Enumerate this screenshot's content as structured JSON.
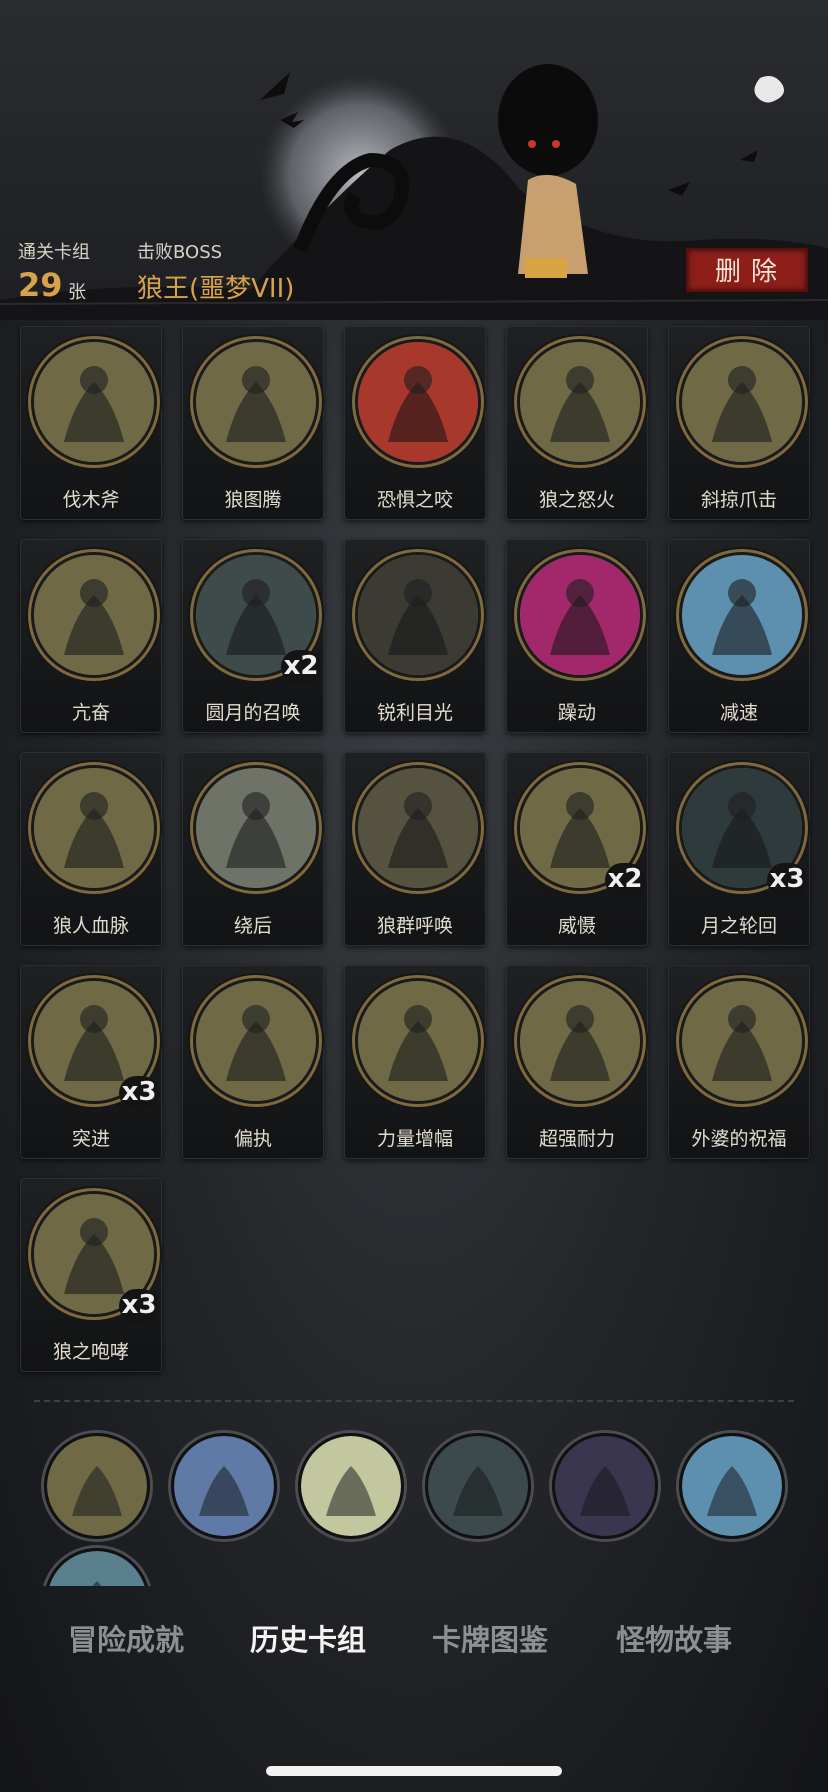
{
  "header": {
    "cleared_decks_label": "通关卡组",
    "cleared_decks_value": "29",
    "cleared_decks_unit": "张",
    "defeated_boss_label": "击败BOSS",
    "defeated_boss_name": "狼王(噩梦VII)",
    "delete_label": "删除"
  },
  "cards": [
    {
      "name": "伐木斧",
      "count": "",
      "icon": "axe-icon",
      "color": "#6f6a45"
    },
    {
      "name": "狼图腾",
      "count": "",
      "icon": "wolf-totem-icon",
      "color": "#6f6a45"
    },
    {
      "name": "恐惧之咬",
      "count": "",
      "icon": "skull-bite-icon",
      "color": "#a8372c"
    },
    {
      "name": "狼之怒火",
      "count": "",
      "icon": "wolf-rage-icon",
      "color": "#6f6a45"
    },
    {
      "name": "斜掠爪击",
      "count": "",
      "icon": "claw-slash-icon",
      "color": "#6f6a45"
    },
    {
      "name": "亢奋",
      "count": "",
      "icon": "werewolf-excite-icon",
      "color": "#6f6a45"
    },
    {
      "name": "圆月的召唤",
      "count": "x2",
      "icon": "full-moon-icon",
      "color": "#3f4a4a"
    },
    {
      "name": "锐利目光",
      "count": "",
      "icon": "sharp-eyes-icon",
      "color": "#3b3b33"
    },
    {
      "name": "躁动",
      "count": "",
      "icon": "restless-icon",
      "color": "#a3286b"
    },
    {
      "name": "减速",
      "count": "",
      "icon": "slow-clock-icon",
      "color": "#5d8fae"
    },
    {
      "name": "狼人血脉",
      "count": "",
      "icon": "werewolf-blood-icon",
      "color": "#6f6a45"
    },
    {
      "name": "绕后",
      "count": "",
      "icon": "sneak-behind-icon",
      "color": "#6f7367"
    },
    {
      "name": "狼群呼唤",
      "count": "",
      "icon": "pack-howl-icon",
      "color": "#55533f"
    },
    {
      "name": "威慑",
      "count": "x2",
      "icon": "deterrence-icon",
      "color": "#6f6a45"
    },
    {
      "name": "月之轮回",
      "count": "x3",
      "icon": "moon-cycle-icon",
      "color": "#2f3a3c"
    },
    {
      "name": "突进",
      "count": "x3",
      "icon": "charge-icon",
      "color": "#6f6a45"
    },
    {
      "name": "偏执",
      "count": "",
      "icon": "paranoia-icon",
      "color": "#6f6a45"
    },
    {
      "name": "力量增幅",
      "count": "",
      "icon": "power-log-icon",
      "color": "#6f6a45"
    },
    {
      "name": "超强耐力",
      "count": "",
      "icon": "endurance-icon",
      "color": "#6f6a45"
    },
    {
      "name": "外婆的祝福",
      "count": "",
      "icon": "grandma-blessing-icon",
      "color": "#6f6a45"
    },
    {
      "name": "狼之咆哮",
      "count": "x3",
      "icon": "wolf-roar-icon",
      "color": "#6f6a45"
    }
  ],
  "relics": [
    {
      "icon": "werewolf-relic-icon",
      "color": "#6f6a45"
    },
    {
      "icon": "red-cape-relic-icon",
      "color": "#5f7aa6"
    },
    {
      "icon": "green-potion-relic-icon",
      "color": "#c2c7a0"
    },
    {
      "icon": "tree-stump-relic-icon",
      "color": "#3d4a4d"
    },
    {
      "icon": "coins-relic-icon",
      "color": "#3a3650"
    },
    {
      "icon": "clock-relic-icon",
      "color": "#5d8fae"
    },
    {
      "icon": "partial-relic-icon",
      "color": "#5a7f8e"
    }
  ],
  "tabs": [
    {
      "label": "冒险成就",
      "active": false
    },
    {
      "label": "历史卡组",
      "active": true
    },
    {
      "label": "卡牌图鉴",
      "active": false
    },
    {
      "label": "怪物故事",
      "active": false
    }
  ]
}
